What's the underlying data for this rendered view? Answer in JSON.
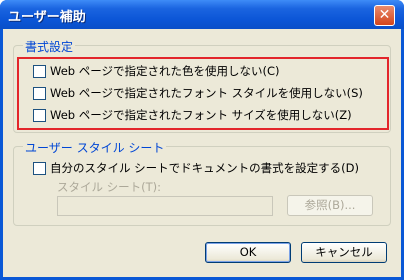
{
  "window": {
    "title": "ユーザー補助",
    "close_glyph": "✕"
  },
  "formatting": {
    "group_label": "書式設定",
    "options": [
      {
        "label": "Web ページで指定された色を使用しない(C)",
        "checked": false
      },
      {
        "label": "Web ページで指定されたフォント スタイルを使用しない(S)",
        "checked": false
      },
      {
        "label": "Web ページで指定されたフォント サイズを使用しない(Z)",
        "checked": false
      }
    ]
  },
  "user_style": {
    "group_label": "ユーザー スタイル シート",
    "checkbox_label": "自分のスタイル シートでドキュメントの書式を設定する(D)",
    "checked": false,
    "field_label": "スタイル シート(T):",
    "field_value": "",
    "browse_button": "参照(B)..."
  },
  "footer": {
    "ok_button": "OK",
    "cancel_button": "キャンセル"
  },
  "colors": {
    "titlebar": "#0a58d6",
    "dialog_bg": "#ece9d8",
    "group_label": "#0046d5",
    "highlight": "#e3262b"
  }
}
